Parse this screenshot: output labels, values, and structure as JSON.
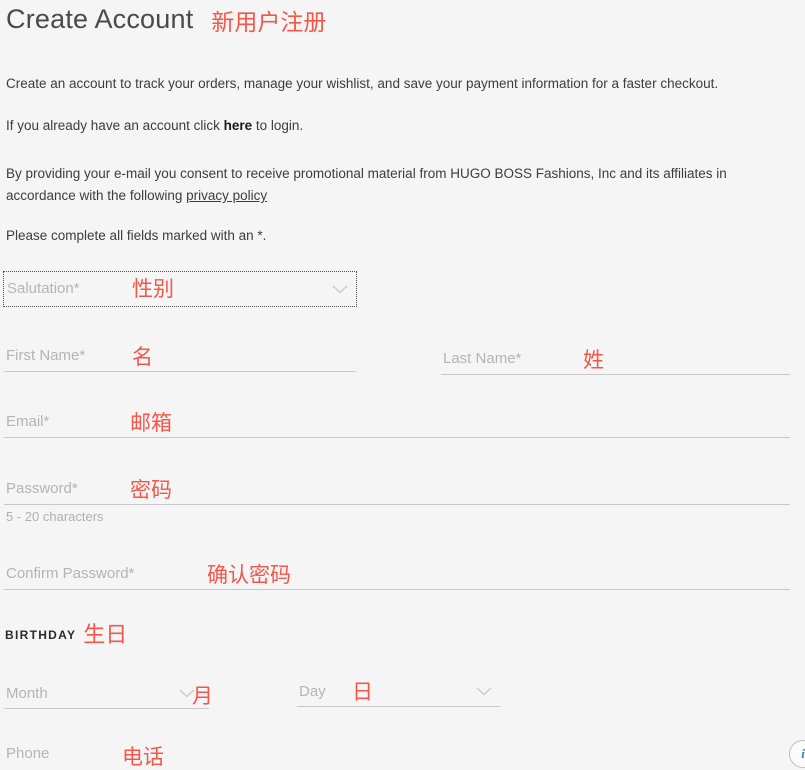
{
  "header": {
    "title": "Create Account",
    "title_annotation": "新用户注册"
  },
  "intro": {
    "line1": "Create an account to track your orders, manage your wishlist, and save your payment information for a faster checkout.",
    "line2_prefix": "If you already have an account click ",
    "line2_link": "here",
    "line2_suffix": " to login.",
    "line3_prefix": "By providing your e-mail you consent to receive promotional material from HUGO BOSS Fashions, Inc and its affiliates in accordance with the following ",
    "line3_link": "privacy policy",
    "line4": "Please complete all fields marked with an *."
  },
  "form": {
    "salutation": {
      "label": "Salutation*",
      "annotation": "性别",
      "value": "",
      "icon": "chevron-down-icon"
    },
    "first_name": {
      "label": "First Name*",
      "annotation": "名",
      "value": ""
    },
    "last_name": {
      "label": "Last Name*",
      "annotation": "姓",
      "value": ""
    },
    "email": {
      "label": "Email*",
      "annotation": "邮箱",
      "value": ""
    },
    "password": {
      "label": "Password*",
      "annotation": "密码",
      "value": "",
      "hint": "5 - 20 characters"
    },
    "confirm_password": {
      "label": "Confirm Password*",
      "annotation": "确认密码",
      "value": ""
    },
    "birthday": {
      "section_label": "BIRTHDAY",
      "section_annotation": "生日",
      "month": {
        "label": "Month",
        "annotation": "月",
        "value": "",
        "icon": "chevron-down-icon"
      },
      "day": {
        "label": "Day",
        "annotation": "日",
        "value": "",
        "icon": "chevron-down-icon"
      }
    },
    "phone": {
      "label": "Phone",
      "annotation": "电话",
      "value": ""
    }
  },
  "overlay": {
    "info_badge": "i"
  },
  "colors": {
    "annotation_red": "#f4564a",
    "page_background": "#f5f5f5",
    "placeholder_gray": "#b4b4b4",
    "underline_gray": "#c8c8c8"
  }
}
